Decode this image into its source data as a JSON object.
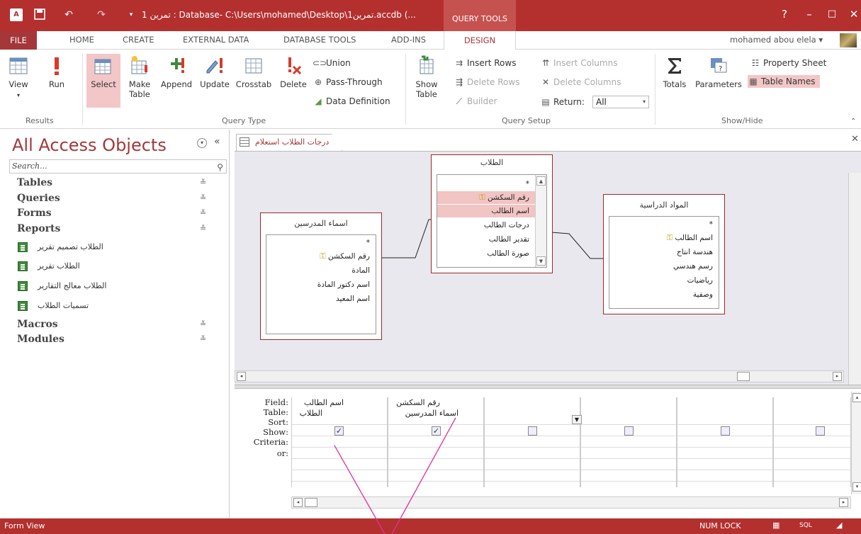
{
  "titlebar": {
    "title": "تمرين 1 : Database- C:\\Users\\mohamed\\Desktop\\تمرين1.accdb (...",
    "contextual_tab": "QUERY TOOLS",
    "help": "?",
    "minimize": "–",
    "maximize": "□",
    "close": "✕"
  },
  "tabs": {
    "file": "FILE",
    "home": "HOME",
    "create": "CREATE",
    "external": "EXTERNAL DATA",
    "dbtools": "DATABASE TOOLS",
    "addins": "ADD-INS",
    "design": "DESIGN"
  },
  "user": {
    "name": "mohamed abou elela",
    "dropdown": "▾"
  },
  "ribbon": {
    "results": {
      "view": "View",
      "run": "Run",
      "label": "Results"
    },
    "query_type": {
      "select": "Select",
      "make_table_1": "Make",
      "make_table_2": "Table",
      "append": "Append",
      "update": "Update",
      "crosstab": "Crosstab",
      "delete": "Delete",
      "union": "Union",
      "pass_through": "Pass-Through",
      "data_definition": "Data Definition",
      "label": "Query Type"
    },
    "query_setup": {
      "show_table_1": "Show",
      "show_table_2": "Table",
      "insert_rows": "Insert Rows",
      "delete_rows": "Delete Rows",
      "builder": "Builder",
      "insert_columns": "Insert Columns",
      "delete_columns": "Delete Columns",
      "return_label": "Return:",
      "return_value": "All",
      "label": "Query Setup"
    },
    "show_hide": {
      "totals": "Totals",
      "parameters": "Parameters",
      "property_sheet": "Property Sheet",
      "table_names": "Table Names",
      "label": "Show/Hide"
    }
  },
  "nav": {
    "title": "All Access Objects",
    "search_placeholder": "Search...",
    "groups": {
      "tables": "Tables",
      "queries": "Queries",
      "forms": "Forms",
      "reports": "Reports",
      "macros": "Macros",
      "modules": "Modules"
    },
    "reports": [
      "الطلاب تصميم تقرير",
      "الطلاب تقرير",
      "الطلاب معالج التقارير",
      "تسميات الطلاب"
    ]
  },
  "document": {
    "tab_label": "درجات الطلاب استعلام"
  },
  "tables": {
    "students": {
      "title": "الطلاب",
      "fields": [
        "*",
        "رقم السكشن",
        "اسم الطالب",
        "درجات الطالب",
        "تقدير الطالب",
        "صورة الطالب"
      ]
    },
    "teachers": {
      "title": "اسماء المدرسين",
      "fields": [
        "*",
        "رقم السكشن",
        "المادة",
        "اسم دكتور المادة",
        "اسم المعيد"
      ]
    },
    "subjects": {
      "title": "المواد الدراسية",
      "fields": [
        "*",
        "اسم الطالب",
        "هندسة انتاج",
        "رسم هندسي",
        "رياضيات",
        "وصفية"
      ]
    }
  },
  "qbe": {
    "labels": {
      "field": "Field:",
      "table": "Table:",
      "sort": "Sort:",
      "show": "Show:",
      "criteria": "Criteria:",
      "or": "or:"
    },
    "columns": [
      {
        "field": "اسم الطالب",
        "table": "الطلاب"
      },
      {
        "field": "رقم السكشن",
        "table": "اسماء المدرسين"
      }
    ],
    "checkmark": "✓"
  },
  "status": {
    "text": "Form View",
    "numlock": "NUM LOCK",
    "sql": "SQL"
  },
  "colors": {
    "accent": "#a4373a",
    "titlebar": "#b3302f",
    "selected": "#f3c7c7",
    "annotation": "#e0309a"
  }
}
